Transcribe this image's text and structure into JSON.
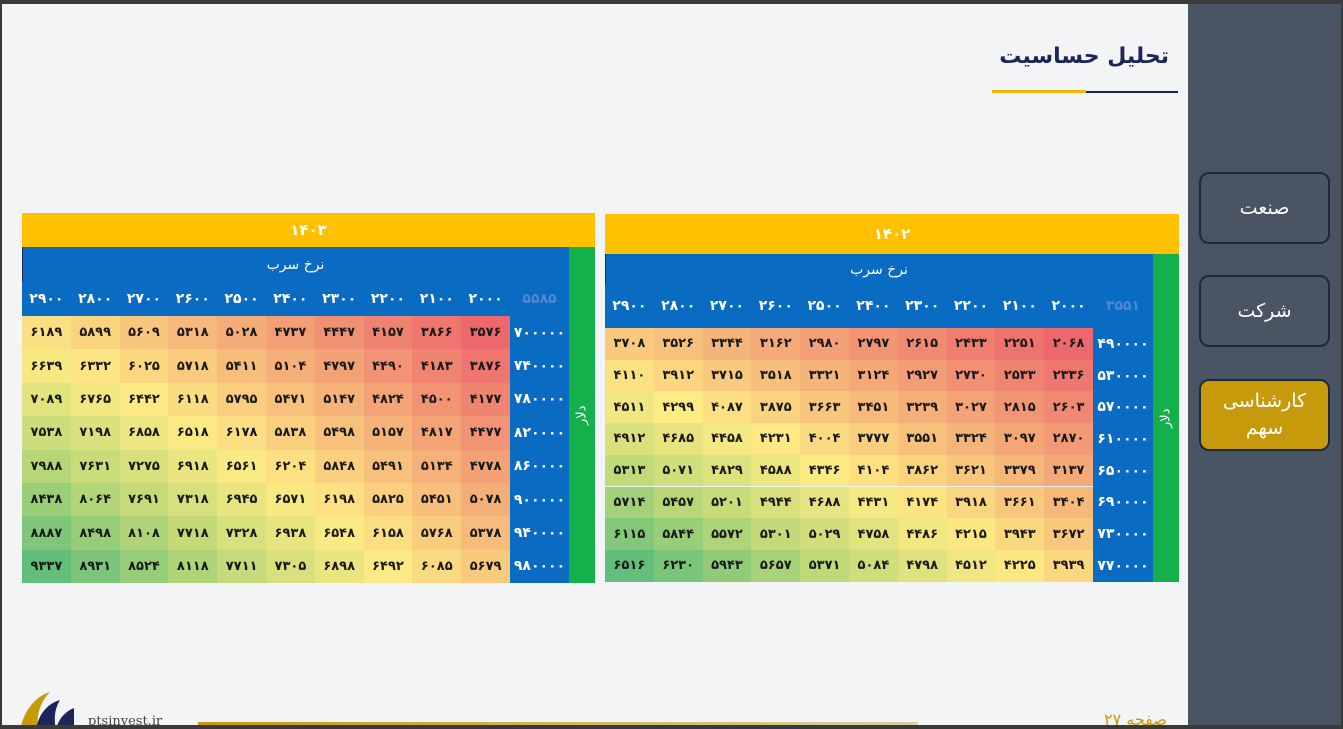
{
  "title": "تحلیل حساسیت",
  "nav": [
    {
      "label": "صنعت"
    },
    {
      "label": "شرکت"
    },
    {
      "label": "کارشناسی\nسهم"
    }
  ],
  "footer": {
    "url": "ptsinvest.ir",
    "page": "صفحه ۲۷"
  },
  "colors": {
    "gold": "#ffc000",
    "blue": "#0a6bc2",
    "green": "#13b04b",
    "sidebar": "#4a5563",
    "active": "#c79a0c"
  },
  "tables": [
    {
      "year": "۱۴۰۲",
      "x_label": "نرخ سرب",
      "y_label": "دلار",
      "corner": "۳۵۵۱",
      "cols": [
        "۲۰۰۰",
        "۲۱۰۰",
        "۲۲۰۰",
        "۲۳۰۰",
        "۲۴۰۰",
        "۲۵۰۰",
        "۲۶۰۰",
        "۲۷۰۰",
        "۲۸۰۰",
        "۲۹۰۰"
      ],
      "rows": [
        {
          "h": "۴۹۰۰۰۰",
          "v": [
            2068,
            2251,
            2433,
            2615,
            2797,
            2980,
            3162,
            3344,
            3526,
            3708
          ]
        },
        {
          "h": "۵۳۰۰۰۰",
          "v": [
            2336,
            2533,
            2730,
            2927,
            3124,
            3321,
            3518,
            3715,
            3912,
            4110
          ]
        },
        {
          "h": "۵۷۰۰۰۰",
          "v": [
            2603,
            2815,
            3027,
            3239,
            3451,
            3663,
            3875,
            4087,
            4299,
            4511
          ]
        },
        {
          "h": "۶۱۰۰۰۰",
          "v": [
            2870,
            3097,
            3324,
            3551,
            3777,
            4004,
            4231,
            4458,
            4685,
            4912
          ]
        },
        {
          "h": "۶۵۰۰۰۰",
          "v": [
            3137,
            3379,
            3621,
            3862,
            4104,
            4346,
            4588,
            4829,
            5071,
            5313
          ]
        },
        {
          "h": "۶۹۰۰۰۰",
          "v": [
            3404,
            3661,
            3918,
            4174,
            4431,
            4688,
            4944,
            5201,
            5457,
            5714
          ]
        },
        {
          "h": "۷۳۰۰۰۰",
          "v": [
            3672,
            3943,
            4215,
            4486,
            4758,
            5029,
            5301,
            5572,
            5844,
            6115
          ]
        },
        {
          "h": "۷۷۰۰۰۰",
          "v": [
            3939,
            4225,
            4512,
            4798,
            5084,
            5371,
            5657,
            5943,
            6230,
            6516
          ]
        }
      ]
    },
    {
      "year": "۱۴۰۳",
      "x_label": "نرخ سرب",
      "y_label": "دلار",
      "corner": "۵۵۸۵",
      "cols": [
        "۲۰۰۰",
        "۲۱۰۰",
        "۲۲۰۰",
        "۲۳۰۰",
        "۲۴۰۰",
        "۲۵۰۰",
        "۲۶۰۰",
        "۲۷۰۰",
        "۲۸۰۰",
        "۲۹۰۰"
      ],
      "rows": [
        {
          "h": "۷۰۰۰۰۰",
          "v": [
            3576,
            3866,
            4157,
            4447,
            4737,
            5028,
            5318,
            5609,
            5899,
            6189
          ]
        },
        {
          "h": "۷۴۰۰۰۰",
          "v": [
            3876,
            4183,
            4490,
            4797,
            5104,
            5411,
            5718,
            6025,
            6332,
            6639
          ]
        },
        {
          "h": "۷۸۰۰۰۰",
          "v": [
            4177,
            4500,
            4824,
            5147,
            5471,
            5795,
            6118,
            6442,
            6765,
            7089
          ]
        },
        {
          "h": "۸۲۰۰۰۰",
          "v": [
            4477,
            4817,
            5157,
            5498,
            5838,
            6178,
            6518,
            6858,
            7198,
            7538
          ]
        },
        {
          "h": "۸۶۰۰۰۰",
          "v": [
            4778,
            5134,
            5491,
            5848,
            6204,
            6561,
            6918,
            7275,
            7631,
            7988
          ]
        },
        {
          "h": "۹۰۰۰۰۰",
          "v": [
            5078,
            5451,
            5825,
            6198,
            6571,
            6945,
            7318,
            7691,
            8064,
            8438
          ]
        },
        {
          "h": "۹۴۰۰۰۰",
          "v": [
            5378,
            5768,
            6158,
            6548,
            6938,
            7328,
            7718,
            8108,
            8498,
            8887
          ]
        },
        {
          "h": "۹۸۰۰۰۰",
          "v": [
            5679,
            6085,
            6492,
            6898,
            7305,
            7711,
            8118,
            8524,
            8931,
            9337
          ]
        }
      ]
    }
  ]
}
